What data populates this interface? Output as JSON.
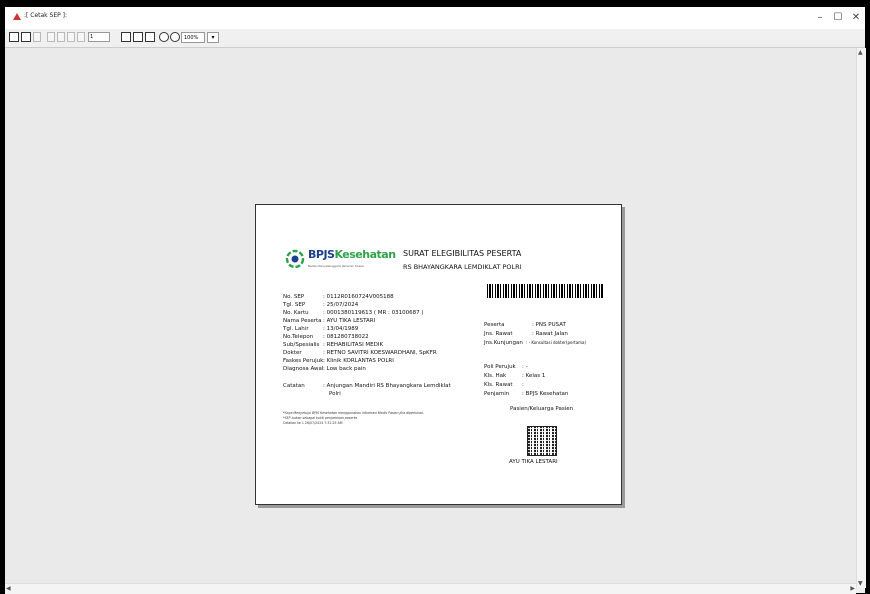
{
  "window": {
    "title": ":[ Cetak SEP ]:"
  },
  "toolbar": {
    "page_value": "1",
    "zoom": "100%"
  },
  "document": {
    "logo_brand_1": "BPJS",
    "logo_brand_2": "Kesehatan",
    "logo_tagline": "Badan Penyelenggara Jaminan Sosial",
    "title": "SURAT ELEGIBILITAS PESERTA",
    "subtitle": "RS BHAYANGKARA LEMDIKLAT POLRI",
    "fields_left": [
      {
        "label": "No. SEP",
        "value": ": 0112R0160724V005188"
      },
      {
        "label": "Tgl. SEP",
        "value": ": 25/07/2024"
      },
      {
        "label": "No. Kartu",
        "value": ": 0001380119613 ( MR : 03100687 )"
      },
      {
        "label": "Nama Peserta",
        "value": ": AYU TIKA LESTARI"
      },
      {
        "label": "Tgl. Lahir",
        "value": ": 13/04/1989"
      },
      {
        "label": "No.Telepon",
        "value": ": 081280738022"
      },
      {
        "label": "Sub/Spesialis",
        "value": ": REHABILITASI MEDIK"
      },
      {
        "label": "Dokter",
        "value": ": RETNO SAVITRI KOESWARDHANI, SpKFR"
      },
      {
        "label": "Faskes Perujuk",
        "value": ": Klinik KORLANTAS POLRI"
      },
      {
        "label": "Diagnosa Awal",
        "value": ": Low back pain"
      }
    ],
    "catatan_label": "Catatan",
    "catatan_line1": ": Anjungan Mandiri RS Bhayangkara Lemdiklat",
    "catatan_line2": "Polri",
    "fields_right_top": [
      {
        "label": "Peserta",
        "value": ": PNS PUSAT"
      },
      {
        "label": "Jns. Rawat",
        "value": ": Rawat Jalan"
      },
      {
        "label": "Jns.Kunjungan",
        "value": ": - Konsultasi dokter(pertama)"
      }
    ],
    "fields_right_mid": [
      {
        "label": "Poli Perujuk",
        "value": ": -"
      },
      {
        "label": "Kls. Hak",
        "value": ": Kelas 1"
      },
      {
        "label": "Kls. Rawat",
        "value": ":"
      },
      {
        "label": "Penjamin",
        "value": ": BPJS Kesehatan"
      }
    ],
    "pasien_label": "Pasien/Keluarga Pasien",
    "signature_name": "AYU TIKA LESTARI",
    "note1": "*Saya Menyetujui BPJS Kesehatan menggunakan informasi Medis Pasien jika diperlukan.",
    "note2": "*SEP bukan sebagai bukti penjaminan peserta",
    "print_info": "Cetakan ke 1   26/07/2024 7:31:25 AM"
  },
  "colors": {
    "bpjs_blue": "#1d3f8f",
    "bpjs_green": "#2ea34a"
  }
}
